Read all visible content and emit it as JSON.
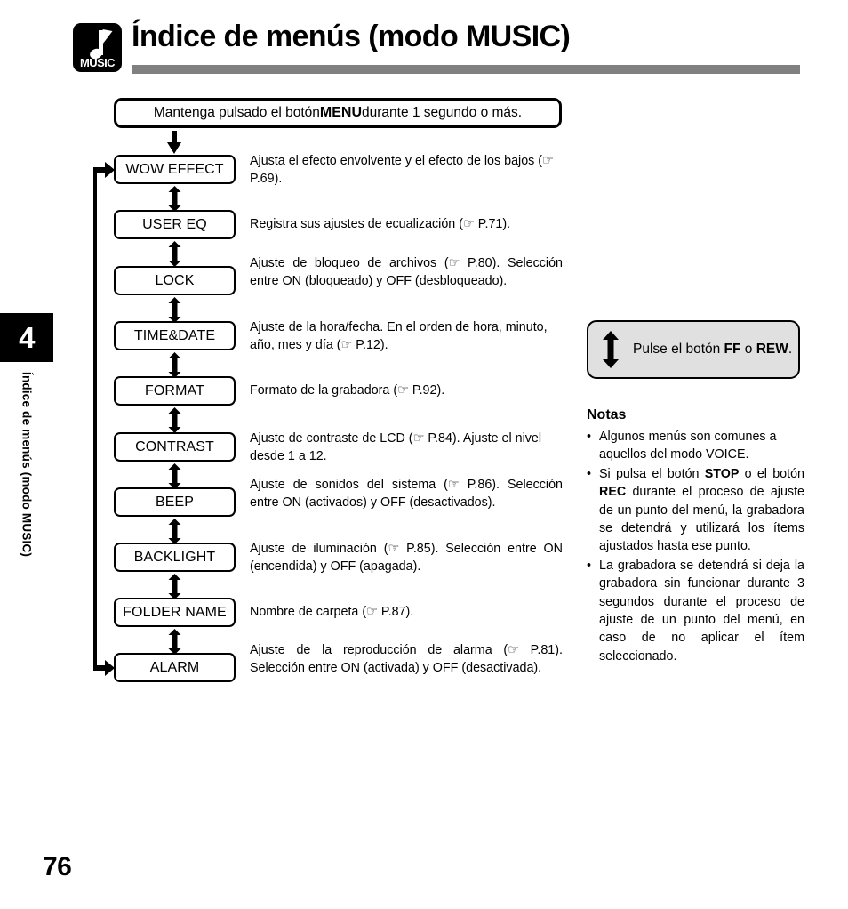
{
  "header": {
    "logo_label": "MUSIC",
    "logo_icon": "music-note-icon",
    "title": "Índice de menús (modo MUSIC)"
  },
  "sidebar": {
    "chapter_number": "4",
    "chapter_title": "Índice de menús (modo MUSIC)"
  },
  "flow": {
    "intro_prefix": "Mantenga pulsado el botón ",
    "intro_strong": "MENU",
    "intro_suffix": " durante 1 segundo o más.",
    "items": [
      {
        "label": "WOW EFFECT",
        "desc": "Ajusta el efecto envolvente y el efecto de los bajos (☞ P.69).",
        "page_ref": "P.69"
      },
      {
        "label": "USER EQ",
        "desc": "Registra sus ajustes de ecualización (☞ P.71).",
        "page_ref": "P.71"
      },
      {
        "label": "LOCK",
        "desc": "Ajuste de bloqueo de archivos  (☞ P.80). Selección entre ON (bloqueado) y OFF (desbloqueado).",
        "page_ref": "P.80"
      },
      {
        "label": "TIME&DATE",
        "desc": "Ajuste de la hora/fecha. En el orden de hora, minuto, año, mes y día (☞ P.12).",
        "page_ref": "P.12"
      },
      {
        "label": "FORMAT",
        "desc": "Formato de la grabadora (☞ P.92).",
        "page_ref": "P.92"
      },
      {
        "label": "CONTRAST",
        "desc": "Ajuste de contraste de LCD (☞ P.84). Ajuste el nivel desde 1 a 12.",
        "page_ref": "P.84"
      },
      {
        "label": "BEEP",
        "desc": "Ajuste de sonidos del sistema (☞ P.86). Selección entre ON (activados) y OFF (desactivados).",
        "page_ref": "P.86"
      },
      {
        "label": "BACKLIGHT",
        "desc": "Ajuste de iluminación (☞ P.85). Selección entre ON (encendida) y OFF (apagada).",
        "page_ref": "P.85"
      },
      {
        "label": "FOLDER NAME",
        "desc": "Nombre de carpeta (☞ P.87).",
        "page_ref": "P.87"
      },
      {
        "label": "ALARM",
        "desc": "Ajuste de la reproducción de alarma (☞ P.81). Selección entre ON (activada) y OFF (desactivada).",
        "page_ref": "P.81"
      }
    ]
  },
  "callout": {
    "icon": "up-down-arrow-icon",
    "prefix": "Pulse el botón ",
    "strong1": "FF",
    "middle": " o ",
    "strong2": "REW",
    "suffix": "."
  },
  "notes": {
    "title": "Notas",
    "bullet": "•",
    "items": [
      {
        "parts": [
          {
            "text": "Algunos menús son comunes a aquellos del modo VOICE.",
            "bold": false
          }
        ]
      },
      {
        "parts": [
          {
            "text": "Si pulsa el botón ",
            "bold": false
          },
          {
            "text": "STOP",
            "bold": true
          },
          {
            "text": " o el botón ",
            "bold": false
          },
          {
            "text": "REC",
            "bold": true
          },
          {
            "text": " durante el proceso de ajuste de un punto del menú, la grabadora se detendrá y utilizará los ítems ajustados hasta ese punto.",
            "bold": false
          }
        ]
      },
      {
        "parts": [
          {
            "text": "La grabadora se detendrá si deja la grabadora sin funcionar durante 3 segundos durante el proceso de ajuste de un punto del menú, en caso de no aplicar el ítem seleccionado.",
            "bold": false
          }
        ]
      }
    ]
  },
  "footer": {
    "page_number": "76"
  },
  "colors": {
    "rule": "#808080",
    "callout_fill": "#e0e0e0",
    "ink": "#000000"
  }
}
